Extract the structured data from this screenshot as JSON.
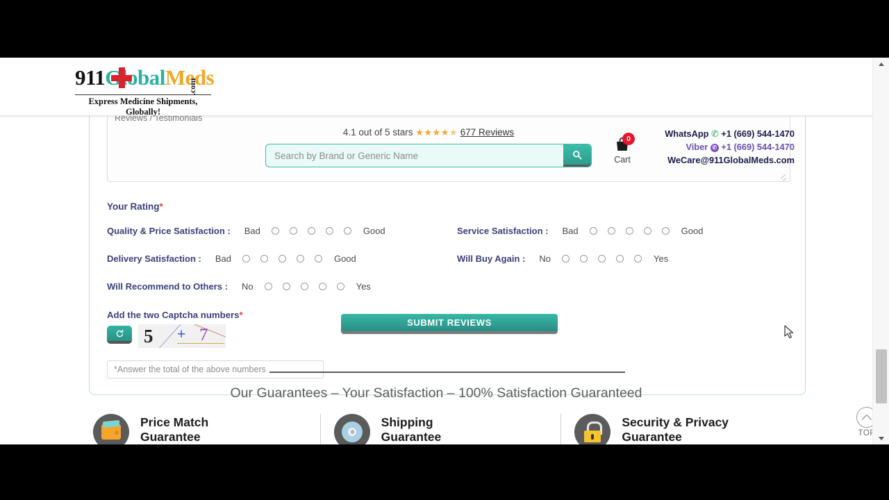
{
  "header": {
    "logo": {
      "part_9": "9",
      "part_11": "11",
      "part_global": "Global",
      "part_meds": "Meds",
      "part_dotcom": ".com",
      "tagline": "Express Medicine Shipments, Globally!"
    },
    "rating": {
      "text": "4.1 out of 5 stars",
      "stars_full": "★★★★",
      "star_half": "★",
      "reviews_link": "677 Reviews",
      "star_color": "#f5a623"
    },
    "search": {
      "placeholder": "Search by Brand or Generic Name",
      "value": "",
      "button_icon": "search-icon"
    },
    "cart": {
      "label": "Cart",
      "badge_count": "0",
      "icon": "shopping-bag-icon",
      "badge_color": "#e8162a"
    },
    "contact": {
      "whatsapp_label": "WhatsApp",
      "whatsapp_number": "+1 (669) 544-1470",
      "viber_label": "Viber",
      "viber_number": "+1 (669) 544-1470",
      "email": "WeCare@911GlobalMeds.com"
    }
  },
  "review_form": {
    "comment_placeholder": "Reviews / Testimonials",
    "comment_value": "",
    "your_rating_label": "Your Rating",
    "required_mark": "*",
    "rows": [
      {
        "label": "Quality & Price Satisfaction :",
        "low": "Bad",
        "high": "Good",
        "options": 5,
        "selected": -1
      },
      {
        "label": "Service Satisfaction :",
        "low": "Bad",
        "high": "Good",
        "options": 5,
        "selected": -1
      },
      {
        "label": "Delivery Satisfaction :",
        "low": "Bad",
        "high": "Good",
        "options": 5,
        "selected": -1
      },
      {
        "label": "Will Buy Again :",
        "low": "No",
        "high": "Yes",
        "options": 5,
        "selected": -1
      },
      {
        "label": "Will Recommend to Others :",
        "low": "No",
        "high": "Yes",
        "options": 5,
        "selected": -1
      }
    ],
    "captcha": {
      "label": "Add the two Captcha numbers",
      "required_mark": "*",
      "refresh_icon": "refresh-icon",
      "number_one": "5",
      "operator": "+",
      "number_two": "7",
      "answer_placeholder": "*Answer the total of the above numbers",
      "answer_value": ""
    },
    "submit_label": "SUBMIT REVIEWS"
  },
  "guarantees": {
    "title": "Our Guarantees – Your Satisfaction – 100% Satisfaction Guaranteed",
    "cards": [
      {
        "line1": "Price Match",
        "line2": "Guarantee",
        "icon": "wallet-icon"
      },
      {
        "line1": "Shipping",
        "line2": "Guarantee",
        "icon": "shipping-wheel-icon"
      },
      {
        "line1": "Security & Privacy",
        "line2": "Guarantee",
        "icon": "lock-icon"
      }
    ]
  },
  "back_to_top": {
    "label": "TOP",
    "icon": "chevron-up-icon"
  }
}
